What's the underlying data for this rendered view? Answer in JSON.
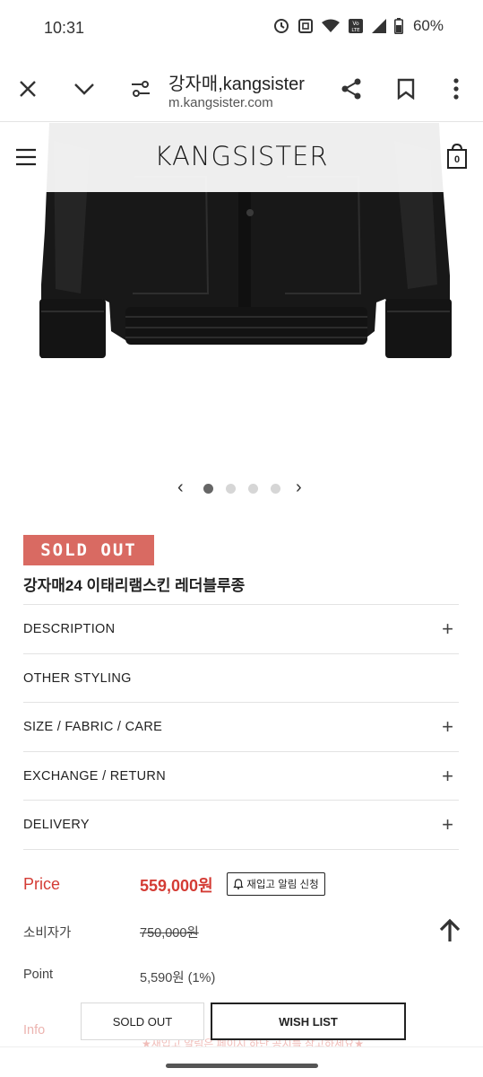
{
  "status": {
    "time": "10:31",
    "battery": "60%",
    "icons": [
      "sync-icon",
      "nfc-icon",
      "wifi-icon",
      "volte-icon",
      "signal-icon",
      "battery-icon"
    ]
  },
  "browser": {
    "title": "강자매,kangsister",
    "domain": "m.kangsister.com",
    "icons": [
      "close-icon",
      "chevron-down-icon",
      "site-settings-icon",
      "share-icon",
      "bookmark-icon",
      "more-icon"
    ]
  },
  "site": {
    "logo": "KANGSISTER",
    "icons": [
      "menu-icon",
      "cart-icon"
    ],
    "cart_count": "0"
  },
  "carousel": {
    "slides": 4,
    "active_index": 1
  },
  "product": {
    "badge": "SOLD OUT",
    "name": "강자매24 이태리램스킨 레더블루종"
  },
  "accordion": [
    {
      "label": "DESCRIPTION",
      "expandable": true
    },
    {
      "label": "OTHER STYLING",
      "expandable": false
    },
    {
      "label": "SIZE / FABRIC / CARE",
      "expandable": true
    },
    {
      "label": "EXCHANGE / RETURN",
      "expandable": true
    },
    {
      "label": "DELIVERY",
      "expandable": true
    }
  ],
  "pricing": {
    "price_label": "Price",
    "price_value": "559,000원",
    "restock_label": "재입고 알림 신청",
    "retail_label": "소비자가",
    "retail_value": "750,000원",
    "point_label": "Point",
    "point_value": "5,590원 (1%)",
    "info_label": "Info",
    "info_notice": "★재입고 알림은 페이지 하단 공지를 참고하세요★"
  },
  "actions": {
    "soldout_label": "SOLD OUT",
    "wishlist_label": "WISH LIST"
  },
  "colors": {
    "accent_red": "#d43c35",
    "badge_red": "#d96a62"
  }
}
